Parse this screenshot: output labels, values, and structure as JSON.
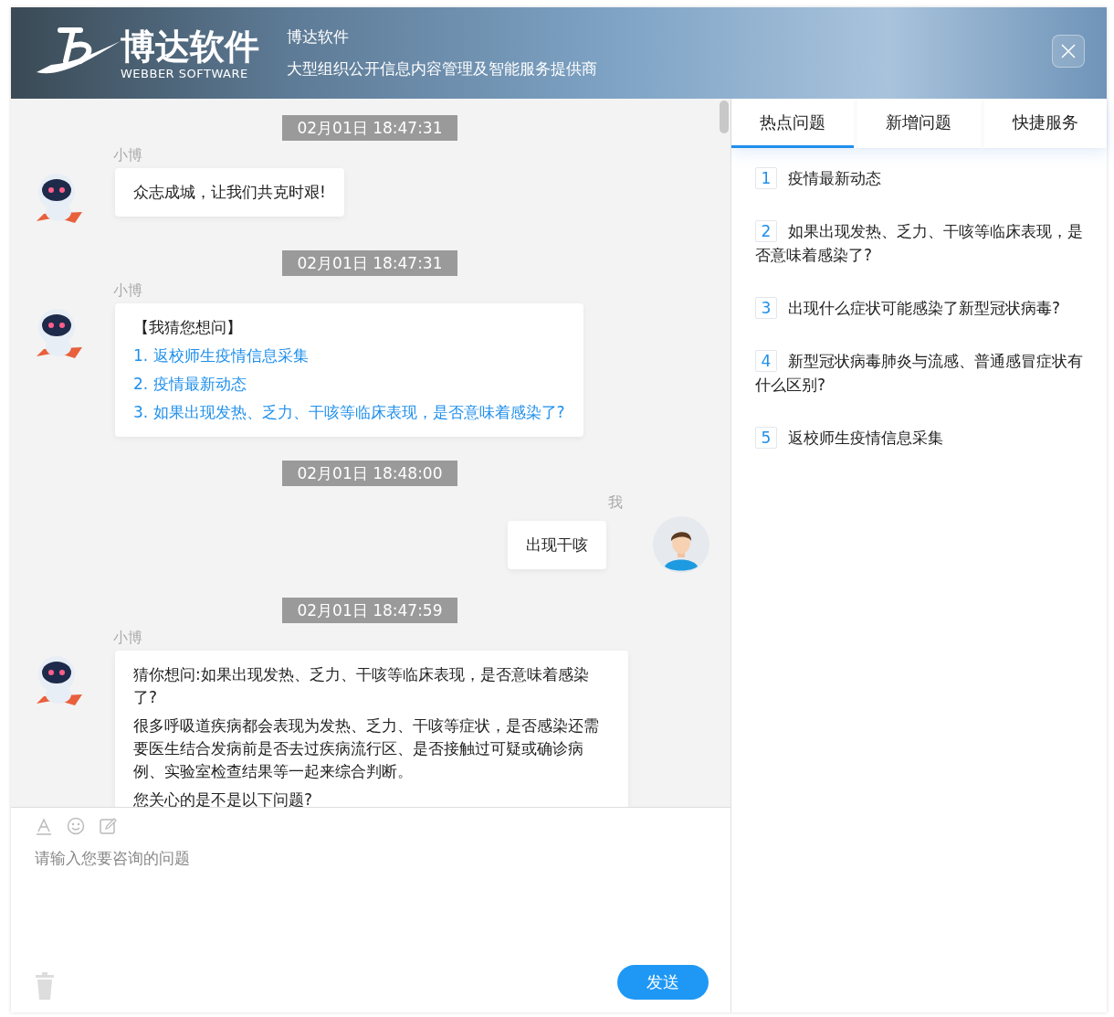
{
  "header": {
    "logo_text": "博达软件",
    "logo_subtext": "WEBBER SOFTWARE",
    "title": "博达软件",
    "subtitle": "大型组织公开信息内容管理及智能服务提供商"
  },
  "messages": [
    {
      "time": "02月01日 18:47:31",
      "sender": "小博",
      "kind": "bot",
      "lines": [
        {
          "kind": "text",
          "text": "众志成城，让我们共克时艰!"
        }
      ]
    },
    {
      "time": "02月01日 18:47:31",
      "sender": "小博",
      "kind": "bot",
      "lines": [
        {
          "kind": "text",
          "text": "【我猜您想问】"
        },
        {
          "kind": "link",
          "text": "1. 返校师生疫情信息采集"
        },
        {
          "kind": "link",
          "text": "2. 疫情最新动态"
        },
        {
          "kind": "link",
          "text": "3. 如果出现发热、乏力、干咳等临床表现，是否意味着感染了?"
        }
      ]
    },
    {
      "time": "02月01日 18:48:00",
      "sender": "我",
      "kind": "user",
      "lines": [
        {
          "kind": "text",
          "text": "出现干咳"
        }
      ]
    },
    {
      "time": "02月01日 18:47:59",
      "sender": "小博",
      "kind": "bot",
      "lines": [
        {
          "kind": "text",
          "text": "猜你想问:如果出现发热、乏力、干咳等临床表现，是否意味着感染了?"
        },
        {
          "kind": "text",
          "text": "很多呼吸道疾病都会表现为发热、乏力、干咳等症状，是否感染还需要医生结合发病前是否去过疾病流行区、是否接触过可疑或确诊病例、实验室检查结果等一起来综合判断。"
        },
        {
          "kind": "text",
          "text": "您关心的是不是以下问题?"
        }
      ]
    }
  ],
  "input": {
    "placeholder": "请输入您要咨询的问题",
    "send_label": "发送"
  },
  "tabs": [
    {
      "label": "热点问题",
      "selected": true
    },
    {
      "label": "新增问题",
      "selected": false
    },
    {
      "label": "快捷服务",
      "selected": false
    }
  ],
  "questions": [
    {
      "number": "1",
      "text": "疫情最新动态"
    },
    {
      "number": "2",
      "text": "如果出现发热、乏力、干咳等临床表现，是否意味着感染了?"
    },
    {
      "number": "3",
      "text": "出现什么症状可能感染了新型冠状病毒?"
    },
    {
      "number": "4",
      "text": "新型冠状病毒肺炎与流感、普通感冒症状有什么区别?"
    },
    {
      "number": "5",
      "text": "返校师生疫情信息采集"
    }
  ]
}
